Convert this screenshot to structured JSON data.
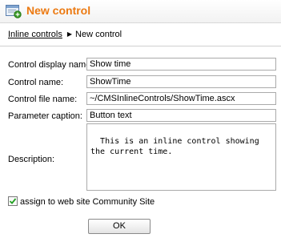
{
  "header": {
    "title": "New control",
    "icon": "new-control-icon"
  },
  "breadcrumb": {
    "parent": "Inline controls",
    "current": "New control"
  },
  "form": {
    "display_name": {
      "label": "Control display name:",
      "value": "Show time"
    },
    "name": {
      "label": "Control name:",
      "value": "ShowTime"
    },
    "file_name": {
      "label": "Control file name:",
      "value": "~/CMSInlineControls/ShowTime.ascx"
    },
    "parameter_caption": {
      "label": "Parameter caption:",
      "value": "Button text"
    },
    "description": {
      "label": "Description:",
      "value": "This is an inline control showing the current time."
    }
  },
  "assign": {
    "label": "assign to web site Community Site",
    "checked": true
  },
  "ok_label": "OK",
  "colors": {
    "title": "#ec7a12",
    "field_border": "#aaaaaa"
  }
}
